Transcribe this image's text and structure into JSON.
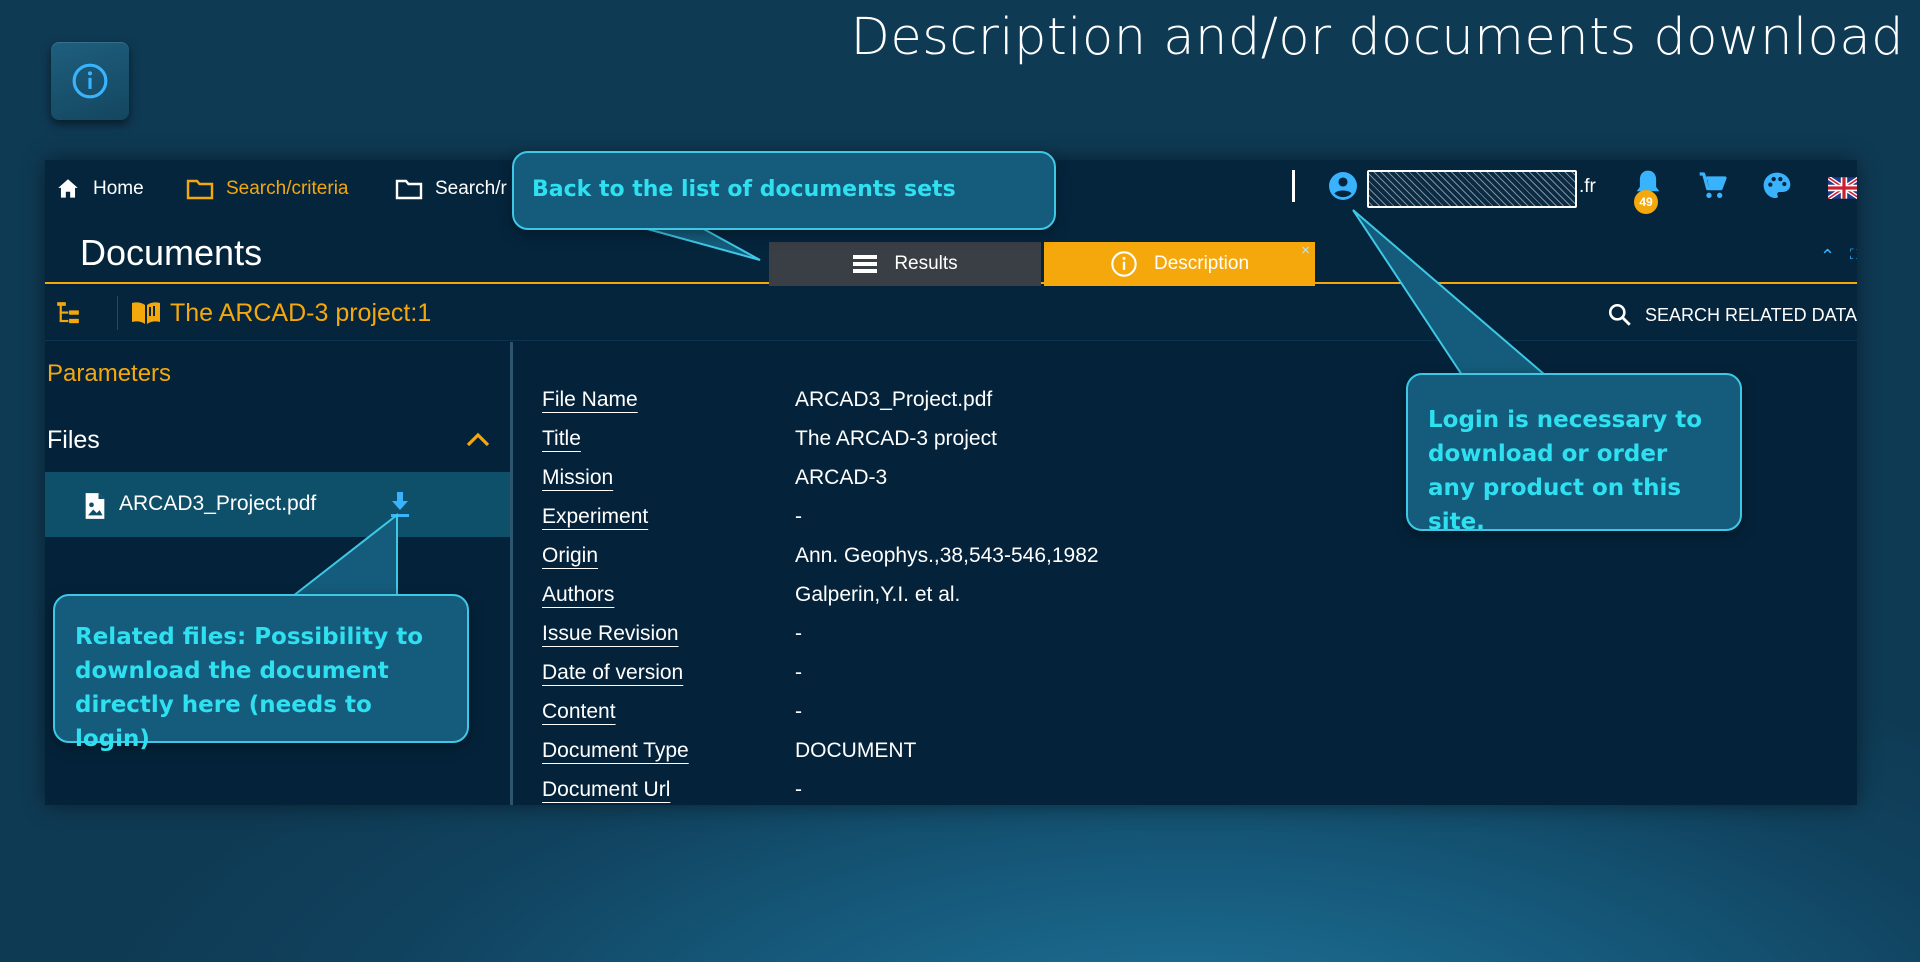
{
  "slide": {
    "title": "Description and/or documents download"
  },
  "navbar": {
    "items": [
      {
        "label": "Home",
        "icon": "home-icon",
        "active": false
      },
      {
        "label": "Search/criteria",
        "icon": "folder-icon",
        "active": true
      },
      {
        "label": "Search/r",
        "icon": "folder-icon",
        "active": false
      }
    ],
    "user_suffix": ".fr",
    "notification_count": "49"
  },
  "header": {
    "title": "Documents",
    "tabs": {
      "results": "Results",
      "description": "Description",
      "close": "×"
    }
  },
  "toolbar": {
    "project_label": "The ARCAD-3 project:1",
    "search_related": "SEARCH RELATED DATA"
  },
  "left_panel": {
    "parameters": "Parameters",
    "files": "Files",
    "file_name": "ARCAD3_Project.pdf"
  },
  "details": [
    {
      "label": "File Name",
      "value": "ARCAD3_Project.pdf"
    },
    {
      "label": "Title",
      "value": "The ARCAD-3 project"
    },
    {
      "label": "Mission",
      "value": "ARCAD-3"
    },
    {
      "label": "Experiment",
      "value": "-"
    },
    {
      "label": "Origin",
      "value": "Ann. Geophys.,38,543-546,1982"
    },
    {
      "label": "Authors",
      "value": "Galperin,Y.I. et al."
    },
    {
      "label": "Issue Revision",
      "value": "-"
    },
    {
      "label": "Date of version",
      "value": "-"
    },
    {
      "label": "Content",
      "value": "-"
    },
    {
      "label": "Document Type",
      "value": "DOCUMENT"
    },
    {
      "label": "Document Url",
      "value": "-"
    }
  ],
  "callouts": {
    "back": "Back to the list of documents sets",
    "login": "Login is necessary to download or order any product on this site.",
    "files": "Related files: Possibility to download the document directly here (needs to login)"
  },
  "colors": {
    "accent": "#f5a80b",
    "panel": "#04233a",
    "callout_text": "#2ee0f0",
    "callout_border": "#3ec8e6",
    "icon_blue": "#3ab3ff"
  }
}
